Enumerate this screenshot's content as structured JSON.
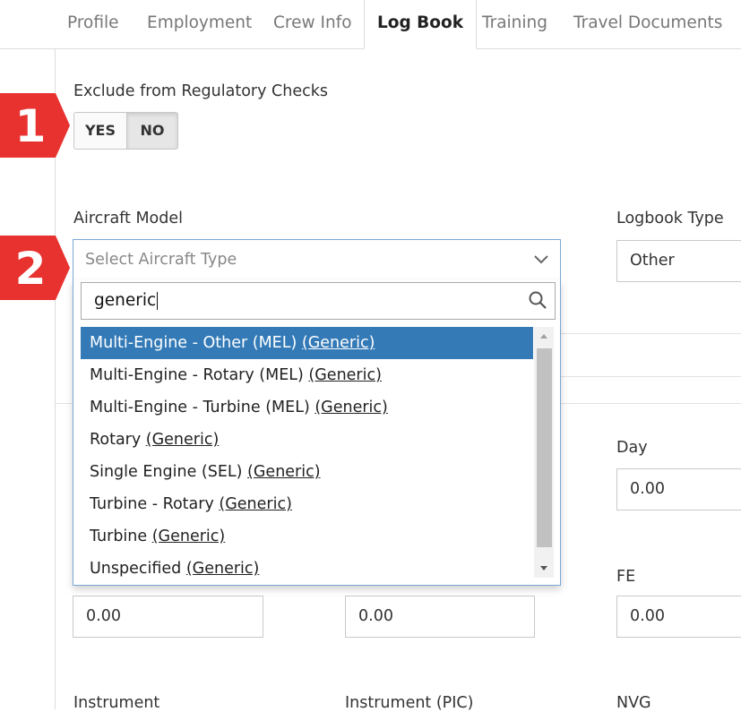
{
  "tabs": [
    {
      "label": "Profile"
    },
    {
      "label": "Employment"
    },
    {
      "label": "Crew Info"
    },
    {
      "label": "Log Book"
    },
    {
      "label": "Training"
    },
    {
      "label": "Travel Documents"
    }
  ],
  "active_tab": "Log Book",
  "regulatory": {
    "label": "Exclude from Regulatory Checks",
    "yes_label": "YES",
    "no_label": "NO",
    "selected": "NO"
  },
  "callouts": {
    "first": "1",
    "second": "2"
  },
  "callout_color": "#e8322f",
  "aircraft_model": {
    "label": "Aircraft Model",
    "placeholder": "Select Aircraft Type",
    "search_value": "generic",
    "options": [
      {
        "name": "Multi-Engine - Other (MEL) ",
        "tag": "(Generic)",
        "highlighted": true
      },
      {
        "name": "Multi-Engine - Rotary (MEL) ",
        "tag": "(Generic)"
      },
      {
        "name": "Multi-Engine - Turbine (MEL) ",
        "tag": "(Generic)"
      },
      {
        "name": "Rotary ",
        "tag": "(Generic)"
      },
      {
        "name": "Single Engine (SEL) ",
        "tag": "(Generic)"
      },
      {
        "name": "Turbine - Rotary ",
        "tag": "(Generic)"
      },
      {
        "name": "Turbine ",
        "tag": "(Generic)"
      },
      {
        "name": "Unspecified ",
        "tag": "(Generic)"
      }
    ]
  },
  "logbook_type": {
    "label": "Logbook Type",
    "value": "Other"
  },
  "day": {
    "label": "Day",
    "value": "0.00"
  },
  "fe": {
    "label": "FE",
    "value": "0.00"
  },
  "field_a": {
    "value": "0.00"
  },
  "field_b": {
    "value": "0.00"
  },
  "instrument": {
    "label": "Instrument"
  },
  "instrument_pic": {
    "label": "Instrument (PIC)"
  },
  "nvg": {
    "label": "NVG"
  },
  "accent_color": "#337ab7"
}
